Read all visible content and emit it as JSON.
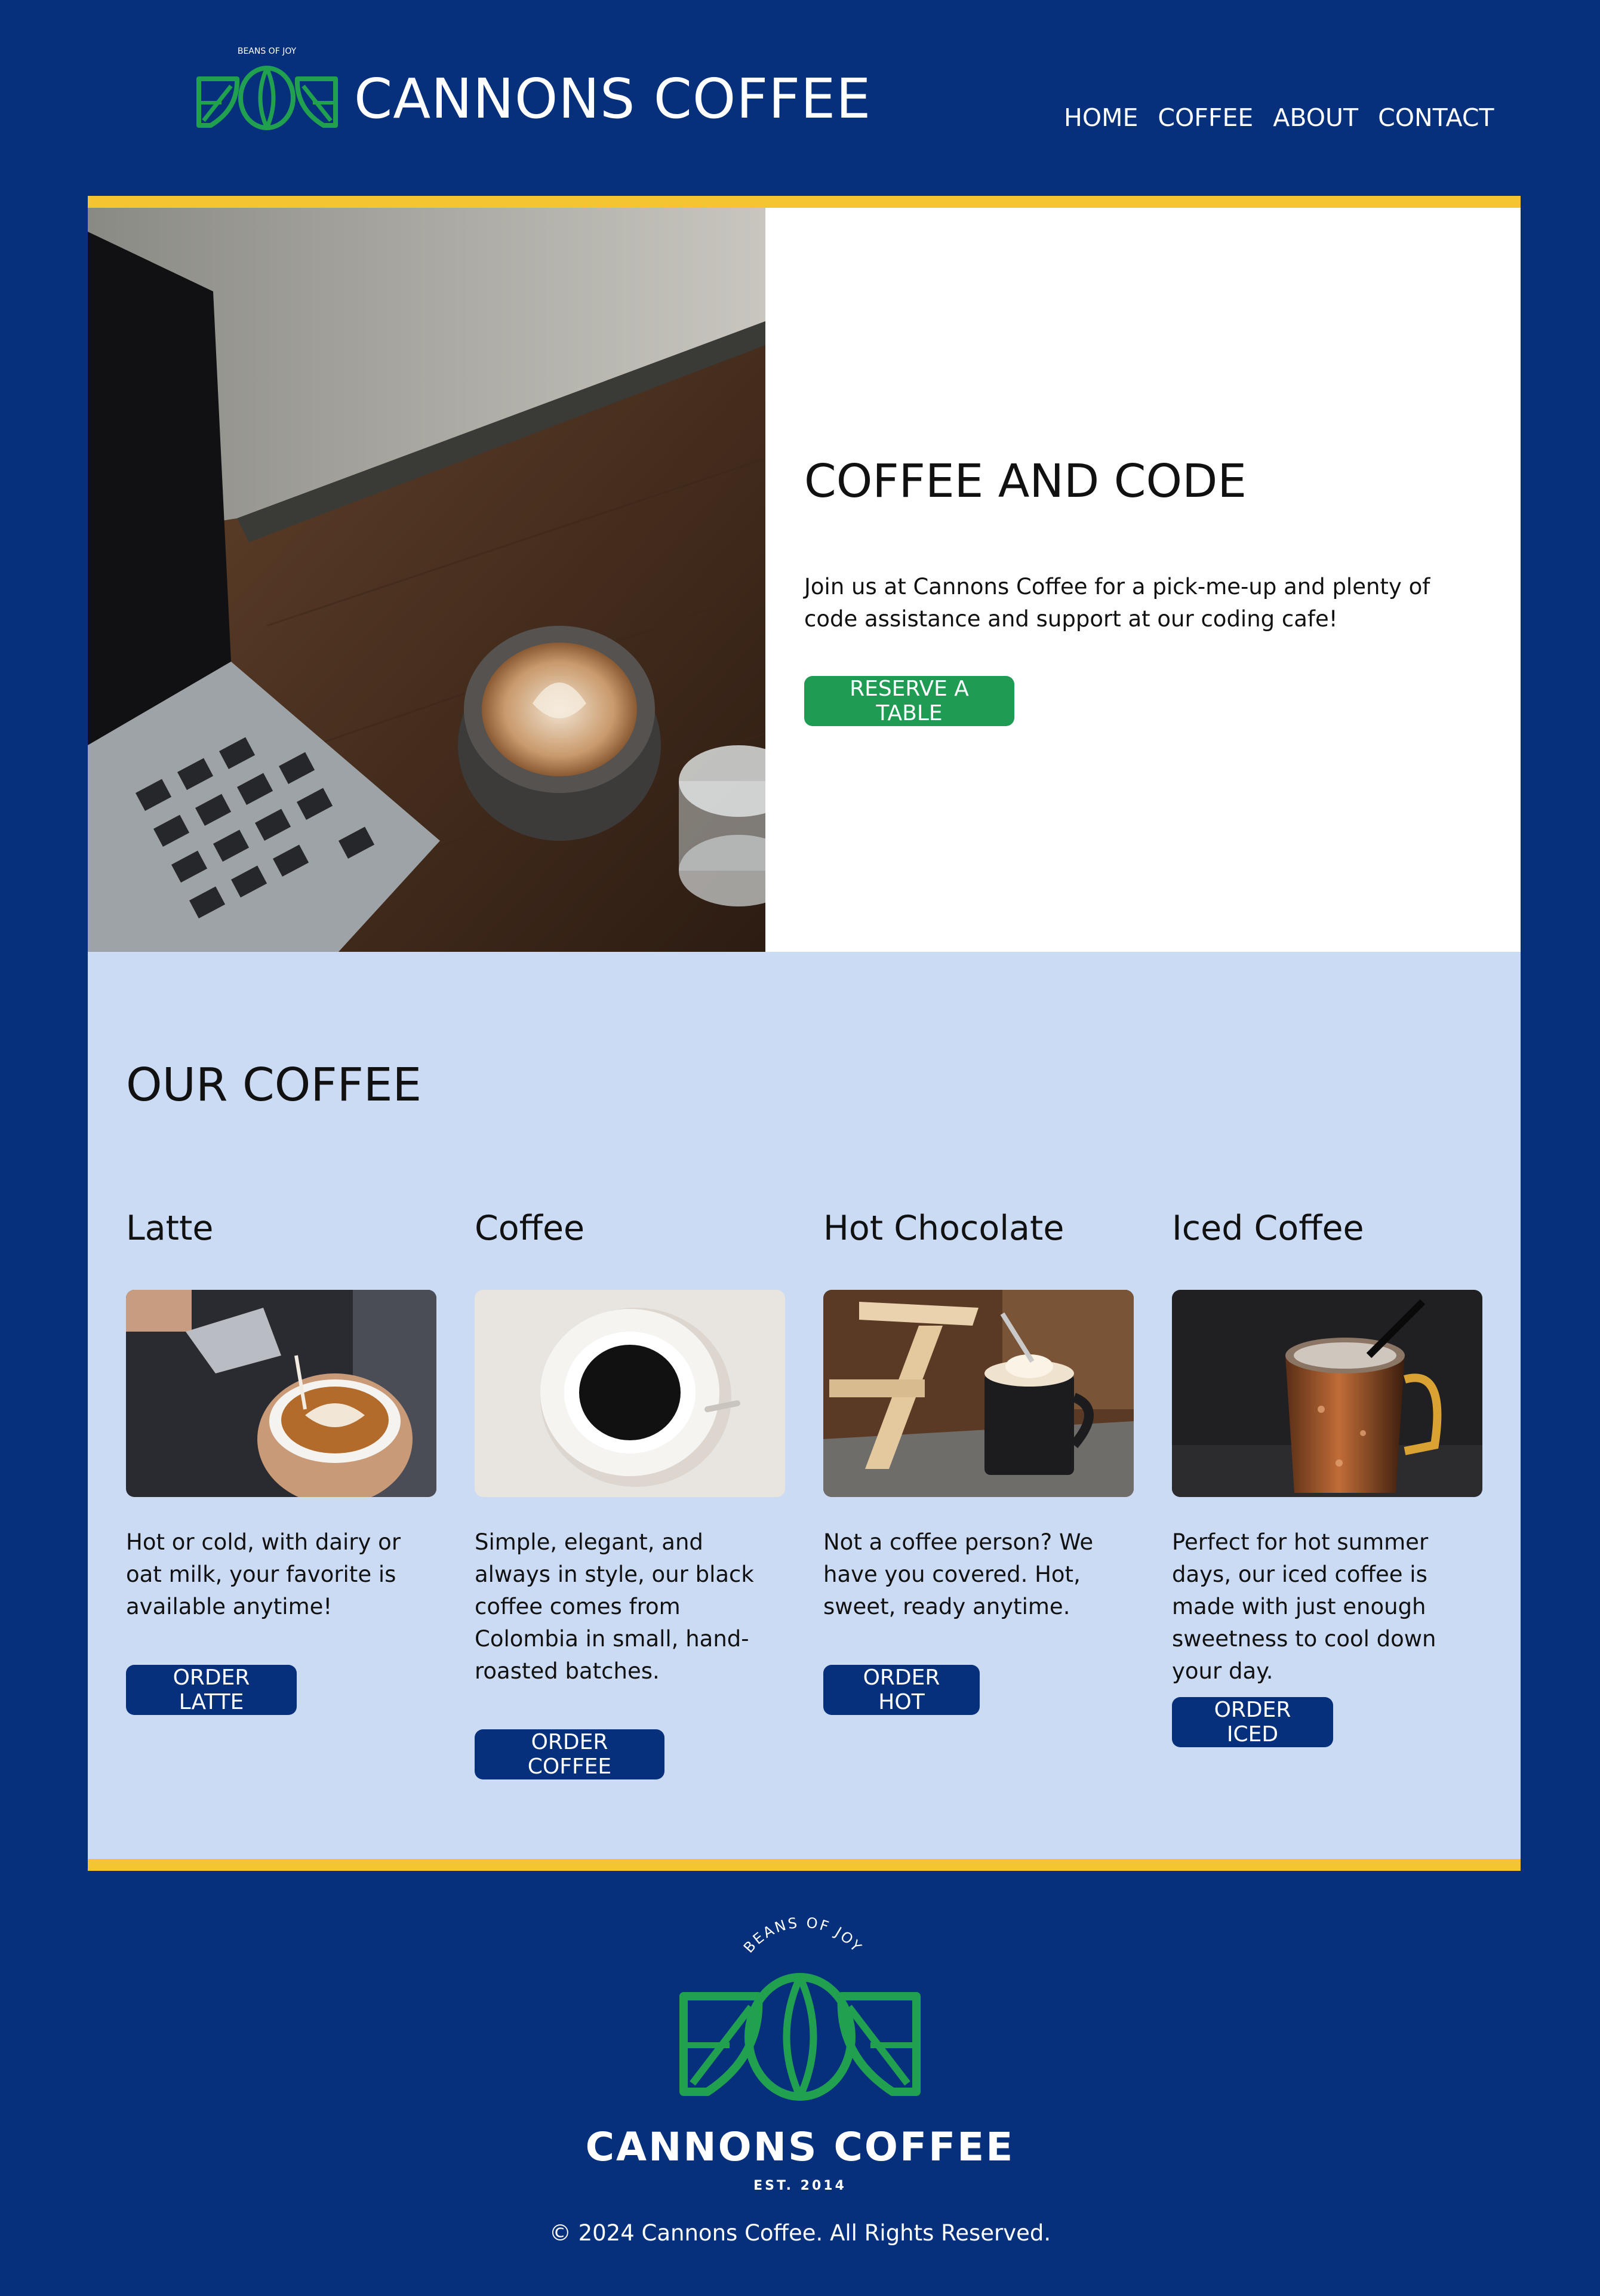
{
  "brand": {
    "name": "CANNONS COFFEE",
    "tagline": "BEANS OF JOY",
    "established": "EST. 2014"
  },
  "nav": [
    "HOME",
    "COFFEE",
    "ABOUT",
    "CONTACT"
  ],
  "hero": {
    "title": "COFFEE AND CODE",
    "description": "Join us at Cannons Coffee for a pick-me-up and plenty of code assistance and support at our coding cafe!",
    "button": "RESERVE A TABLE",
    "image": "laptop-and-latte-photo"
  },
  "coffee_section": {
    "title": "OUR COFFEE",
    "items": [
      {
        "name": "Latte",
        "description": "Hot or cold, with dairy or oat milk, your favorite is available anytime!",
        "button": "ORDER LATTE",
        "image": "latte-art-pour-photo"
      },
      {
        "name": "Coffee",
        "description": "Simple, elegant, and always in style, our black coffee comes from Colombia in small, hand-roasted batches.",
        "button": "ORDER COFFEE",
        "image": "black-coffee-cup-photo"
      },
      {
        "name": "Hot Chocolate",
        "description": "Not a coffee person? We have you covered. Hot, sweet, ready anytime.",
        "button": "ORDER HOT",
        "image": "hot-chocolate-mug-photo"
      },
      {
        "name": "Iced Coffee",
        "description": "Perfect for hot summer days, our iced coffee is made with just enough sweetness to cool down your day.",
        "button": "ORDER ICED",
        "image": "iced-coffee-copper-mug-photo"
      }
    ]
  },
  "footer": {
    "copyright": "© 2024 Cannons Coffee. All Rights Reserved."
  },
  "colors": {
    "background": "#06307c",
    "accent_yellow": "#f5c431",
    "section_light_blue": "#cbdbf4",
    "button_green": "#1f9b54",
    "logo_green": "#21a04f",
    "button_blue": "#06307c"
  }
}
